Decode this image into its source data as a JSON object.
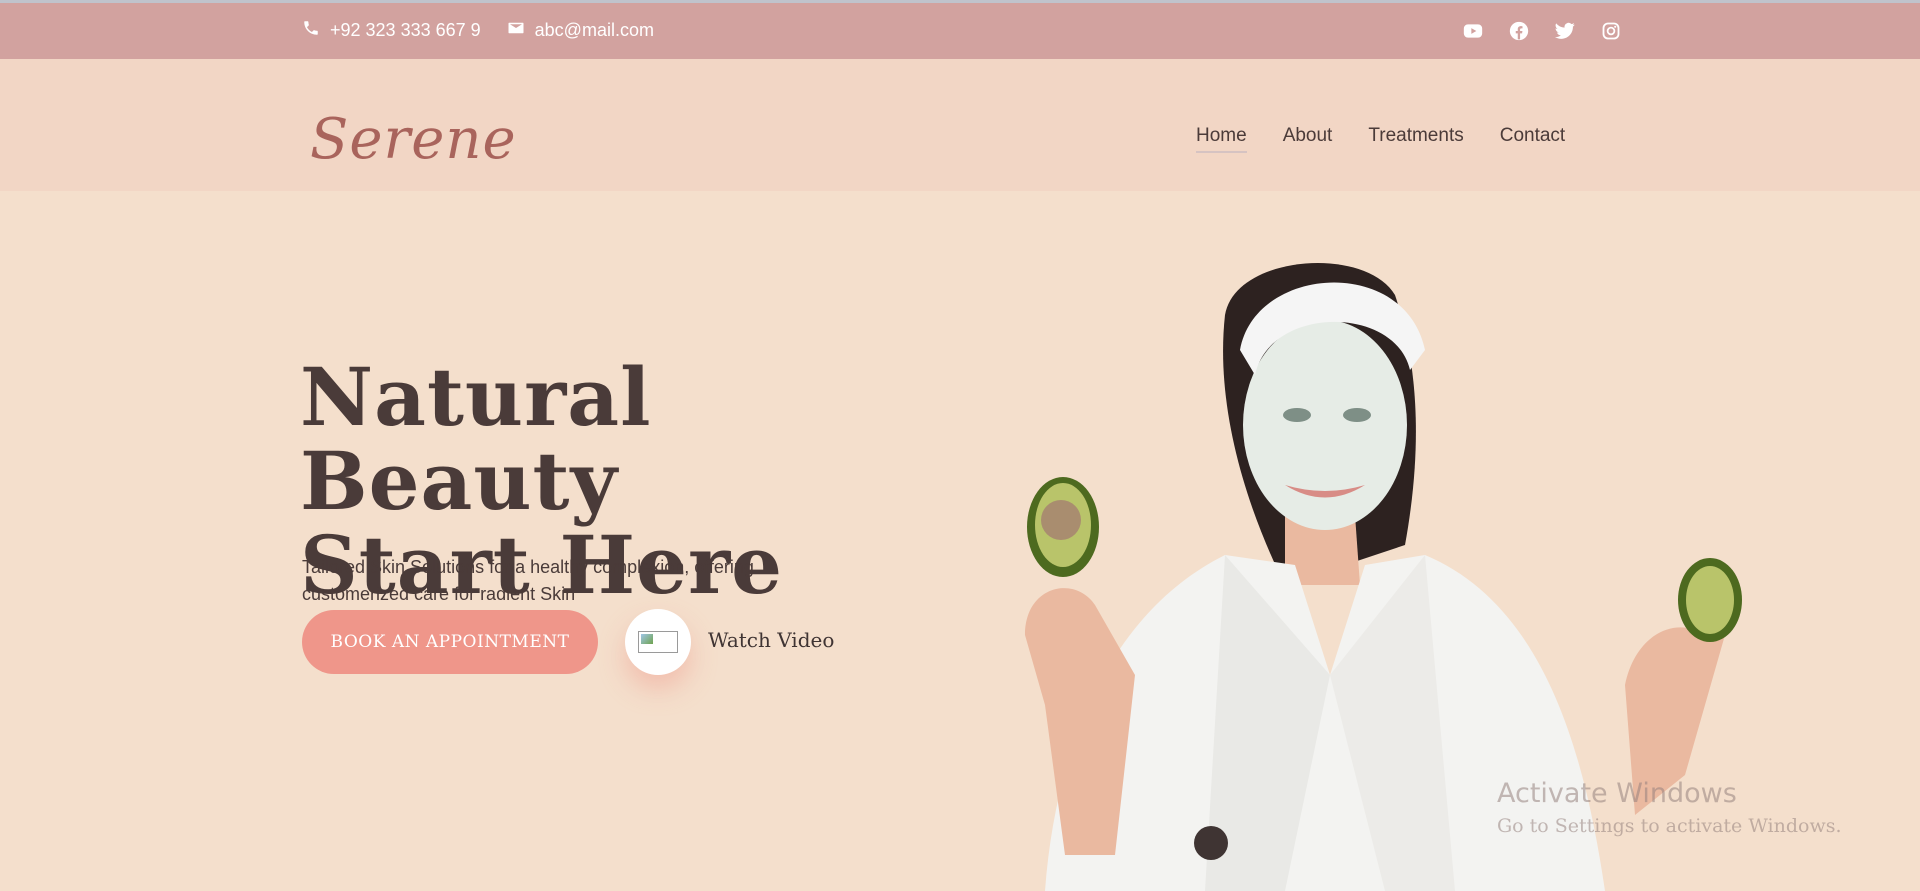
{
  "topbar": {
    "phone": "+92 323 333 667 9",
    "email": "abc@mail.com",
    "social": [
      "youtube-icon",
      "facebook-icon",
      "twitter-icon",
      "instagram-icon"
    ]
  },
  "brand": {
    "logo": "Serene"
  },
  "nav": {
    "items": [
      {
        "label": "Home",
        "active": true
      },
      {
        "label": "About"
      },
      {
        "label": "Treatments"
      },
      {
        "label": "Contact"
      }
    ]
  },
  "hero": {
    "title_line1": "Natural Beauty",
    "title_line2": "Start Here",
    "subtitle": "Tailored Skin Solutions for a healthy complexion, offering customerized care for radient Skin",
    "cta_label": "BOOK AN APPOINTMENT",
    "video_label": "Watch Video"
  },
  "windows": {
    "line1": "Activate Windows",
    "line2": "Go to Settings to activate Windows."
  },
  "colors": {
    "topbar": "#d2a29f",
    "navbar": "#f2d6c5",
    "hero_bg": "#f4dfcc",
    "accent": "#ef968a",
    "text": "#4a3b39"
  }
}
